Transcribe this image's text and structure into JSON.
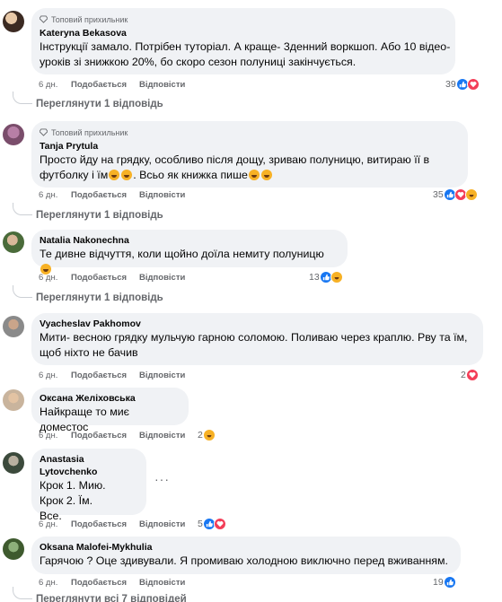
{
  "badge_label": "Топовий прихильник",
  "actions": {
    "like": "Подобається",
    "reply": "Відповісти"
  },
  "comments": [
    {
      "author": "Kateryna Bekasova",
      "text": "Інструкції замало. Потрібен туторіал. А краще- 3денний воркшоп. Або 10 відео-уроків зі знижкою 20%, бо скоро сезон полуниці закінчується.",
      "time": "6 дн.",
      "reaction_count": "39",
      "reactions": [
        "like-icon",
        "love-icon"
      ],
      "view_replies": "Переглянути 1 відповідь"
    },
    {
      "author": "Tanja Prytula",
      "text_a": "Просто йду на грядку, особливо після дощу, зриваю полуницю, витираю її в футболку і їм",
      "text_b": ". Всьо як книжка пише",
      "time": "6 дн.",
      "reaction_count": "35",
      "reactions": [
        "like-icon",
        "love-icon",
        "haha-icon"
      ],
      "view_replies": "Переглянути 1 відповідь"
    },
    {
      "author": "Natalia Nakonechna",
      "text": "Те дивне відчуття, коли щойно доїла немиту полуницю",
      "time": "6 дн.",
      "reaction_count": "13",
      "reactions": [
        "like-icon",
        "haha-icon"
      ],
      "view_replies": "Переглянути 1 відповідь"
    },
    {
      "author": "Vyacheslav Pakhomov",
      "text": "Мити- весною грядку мульчую гарною соломою. Поливаю через краплю. Рву та їм, щоб ніхто не бачив",
      "time": "6 дн.",
      "reaction_count": "2",
      "reactions": [
        "love-icon"
      ]
    },
    {
      "author": "Оксана Желіховська",
      "text": "Найкраще то миє доместос",
      "time": "6 дн.",
      "reaction_count": "2",
      "reactions": [
        "haha-icon"
      ]
    },
    {
      "author": "Anastasia Lytovchenko",
      "text": "Крок 1. Мию.\nКрок 2. Їм.\nВсе.",
      "time": "6 дн.",
      "reaction_count": "5",
      "reactions": [
        "like-icon",
        "love-icon"
      ],
      "more": "···"
    },
    {
      "author": "Oksana Malofei-Mykhulia",
      "text": "Гарячою ? Оце здивували. Я промиваю холодною виключно перед вживанням.",
      "time": "6 дн.",
      "reaction_count": "19",
      "reactions": [
        "like-icon"
      ],
      "view_replies": "Переглянути всі 7 відповідей"
    }
  ],
  "colors": {
    "like": "#1877f2",
    "love": "#f33e58",
    "haha": "#f7b125",
    "bubble": "#f0f2f5",
    "secondary_text": "#65676b"
  }
}
